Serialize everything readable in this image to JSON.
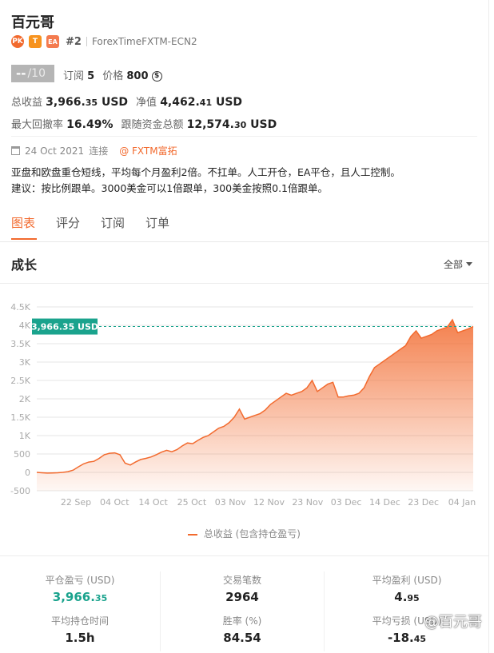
{
  "header": {
    "title": "百元哥",
    "badges": [
      "PK",
      "T",
      "EA"
    ],
    "rank": "#2",
    "server": "ForexTimeFXTM-ECN2"
  },
  "score": {
    "value": "--",
    "denominator": "/10"
  },
  "subscriptions": {
    "label": "订阅",
    "value": "5"
  },
  "price": {
    "label": "价格",
    "value": "800",
    "coin": "$"
  },
  "metrics": {
    "total_profit_label": "总收益",
    "total_profit_main": "3,966.",
    "total_profit_dec": "35",
    "total_profit_unit": "USD",
    "equity_label": "净值",
    "equity_main": "4,462.",
    "equity_dec": "41",
    "equity_unit": "USD",
    "max_drawdown_label": "最大回撤率",
    "max_drawdown": "16.49%",
    "follow_funds_label": "跟随资金总额",
    "follow_funds_main": "12,574.",
    "follow_funds_dec": "30",
    "follow_funds_unit": "USD"
  },
  "connection": {
    "date": "24 Oct 2021",
    "label": "连接",
    "broker": "@ FXTM富拓"
  },
  "description": [
    "亚盘和欧盘重仓短线，平均每个月盈利2倍。不扛单。人工开仓，EA平仓，且人工控制。",
    "建议：按比例跟单。3000美金可以1倍跟单，300美金按照0.1倍跟单。"
  ],
  "tabs": [
    "图表",
    "评分",
    "订阅",
    "订单"
  ],
  "section": {
    "title": "成长",
    "filter": "全部"
  },
  "chart_data": {
    "type": "area",
    "title": "",
    "xlabel": "",
    "ylabel": "",
    "x_ticks": [
      "22 Sep",
      "04 Oct",
      "14 Oct",
      "25 Oct",
      "03 Nov",
      "12 Nov",
      "23 Nov",
      "03 Dec",
      "14 Dec",
      "23 Dec",
      "04 Jan"
    ],
    "y_ticks": [
      "-500",
      "0",
      "500",
      "1K",
      "1.5K",
      "2K",
      "2.5K",
      "3K",
      "3.5K",
      "4K",
      "4.5K"
    ],
    "ylim": [
      -500,
      4500
    ],
    "grid": true,
    "legend_position": "bottom",
    "current_value_label": "3,966.35 USD",
    "current_value": 3966.35,
    "series": [
      {
        "name": "总收益 (包含持仓盈亏)",
        "color": "#f26a2e",
        "values": [
          0,
          -10,
          -20,
          -15,
          -10,
          0,
          20,
          60,
          150,
          230,
          280,
          300,
          380,
          480,
          520,
          530,
          480,
          250,
          200,
          280,
          350,
          380,
          420,
          480,
          550,
          600,
          560,
          620,
          720,
          800,
          780,
          870,
          950,
          1000,
          1100,
          1200,
          1250,
          1350,
          1500,
          1720,
          1450,
          1500,
          1550,
          1600,
          1700,
          1850,
          1950,
          2050,
          2150,
          2100,
          2150,
          2200,
          2300,
          2500,
          2200,
          2300,
          2400,
          2450,
          2050,
          2050,
          2080,
          2100,
          2150,
          2300,
          2600,
          2850,
          2950,
          3050,
          3150,
          3250,
          3350,
          3450,
          3700,
          3850,
          3650,
          3700,
          3750,
          3850,
          3900,
          3950,
          4150,
          3800,
          3850,
          3900,
          3966.35
        ]
      }
    ]
  },
  "stats": [
    {
      "label": "平仓盈亏 (USD)",
      "main": "3,966.",
      "dec": "35",
      "green": true
    },
    {
      "label": "交易笔数",
      "main": "2964",
      "dec": ""
    },
    {
      "label": "平均盈利 (USD)",
      "main": "4.",
      "dec": "95"
    },
    {
      "label": "平均持仓时间",
      "main": "1.5h",
      "dec": ""
    },
    {
      "label": "胜率 (%)",
      "main": "84.54",
      "dec": ""
    },
    {
      "label": "平均亏损 (USD)",
      "main": "-18.",
      "dec": "45"
    }
  ],
  "watermark": "@百元哥"
}
